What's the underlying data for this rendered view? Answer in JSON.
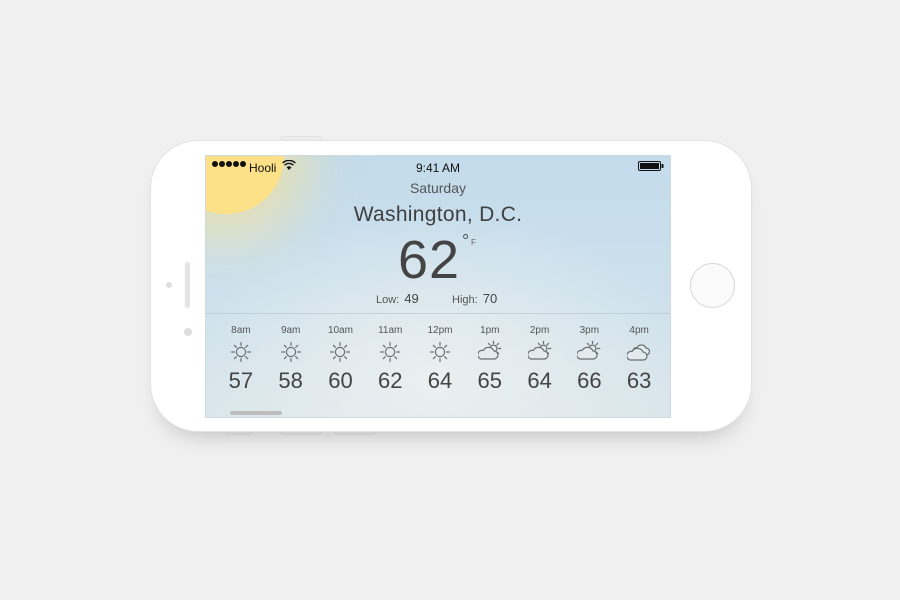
{
  "status_bar": {
    "carrier": "Hooli",
    "time": "9:41 AM",
    "signal_dots": 5
  },
  "weather": {
    "day": "Saturday",
    "city": "Washington, D.C.",
    "temperature": "62",
    "degree_symbol": "°",
    "unit": "F",
    "low_label": "Low:",
    "low_value": "49",
    "high_label": "High:",
    "high_value": "70"
  },
  "hourly": [
    {
      "time": "8am",
      "icon": "sun-icon",
      "temp": "57"
    },
    {
      "time": "9am",
      "icon": "sun-icon",
      "temp": "58"
    },
    {
      "time": "10am",
      "icon": "sun-icon",
      "temp": "60"
    },
    {
      "time": "11am",
      "icon": "sun-icon",
      "temp": "62"
    },
    {
      "time": "12pm",
      "icon": "sun-icon",
      "temp": "64"
    },
    {
      "time": "1pm",
      "icon": "partly-cloudy-icon",
      "temp": "65"
    },
    {
      "time": "2pm",
      "icon": "partly-cloudy-icon",
      "temp": "64"
    },
    {
      "time": "3pm",
      "icon": "partly-cloudy-icon",
      "temp": "66"
    },
    {
      "time": "4pm",
      "icon": "cloudy-icon",
      "temp": "63"
    }
  ],
  "colors": {
    "sun": "#fde189",
    "sky": "#c3dbeb",
    "text": "#444444",
    "icon_stroke": "#6a6f73"
  }
}
